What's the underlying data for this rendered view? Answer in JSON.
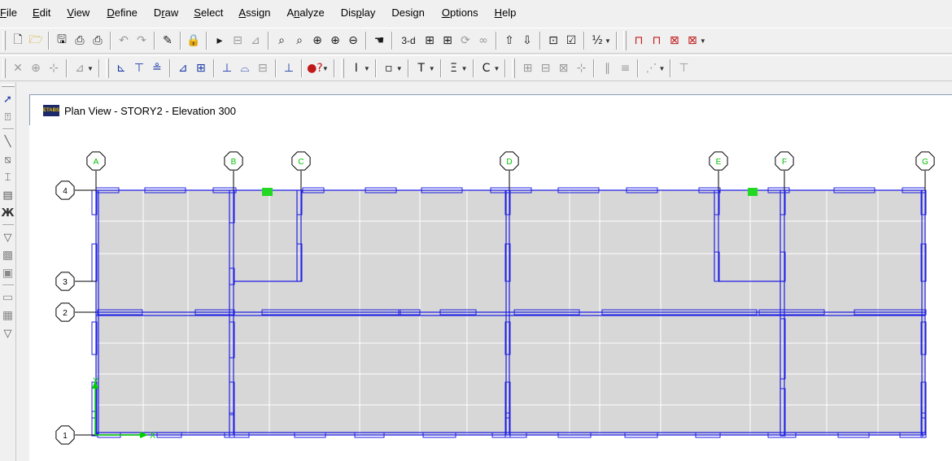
{
  "menu": [
    {
      "id": "file",
      "prefix": "",
      "accel": "F",
      "rest": "ile"
    },
    {
      "id": "edit",
      "prefix": "",
      "accel": "E",
      "rest": "dit"
    },
    {
      "id": "view",
      "prefix": "",
      "accel": "V",
      "rest": "iew"
    },
    {
      "id": "define",
      "prefix": "",
      "accel": "D",
      "rest": "efine"
    },
    {
      "id": "draw",
      "prefix": "D",
      "accel": "r",
      "rest": "aw"
    },
    {
      "id": "select",
      "prefix": "",
      "accel": "S",
      "rest": "elect"
    },
    {
      "id": "assign",
      "prefix": "",
      "accel": "A",
      "rest": "ssign"
    },
    {
      "id": "analyze",
      "prefix": "A",
      "accel": "n",
      "rest": "alyze"
    },
    {
      "id": "display",
      "prefix": "Dis",
      "accel": "p",
      "rest": "lay"
    },
    {
      "id": "design",
      "prefix": "Desi",
      "accel": "g",
      "rest": "n"
    },
    {
      "id": "options",
      "prefix": "",
      "accel": "O",
      "rest": "ptions"
    },
    {
      "id": "help",
      "prefix": "",
      "accel": "H",
      "rest": "elp"
    }
  ],
  "toolbar1": {
    "view3d_label": "3-d"
  },
  "window": {
    "icon_text": "ETABS",
    "title": "Plan View - STORY2 - Elevation 300"
  },
  "plan": {
    "grid_x_labels": [
      "A",
      "B",
      "C",
      "D",
      "E",
      "F",
      "G"
    ],
    "grid_y_labels": [
      "4",
      "3",
      "2",
      "1"
    ],
    "axis_labels": {
      "x": "X",
      "y": "Y"
    },
    "colors": {
      "background": "#d7d7d7",
      "minor_grid": "#ffffff",
      "members": "#1e1ee6",
      "grid_bubble": "#000000",
      "grid_label": "#00c000",
      "axes": "#00d000",
      "selected_joint": "#22d822"
    }
  }
}
